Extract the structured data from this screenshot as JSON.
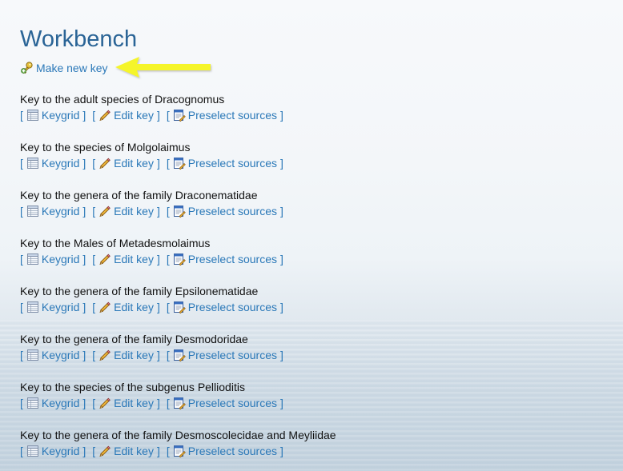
{
  "page": {
    "title": "Workbench",
    "make_new_key": {
      "label": "Make new key",
      "icon": "key-add-icon"
    },
    "annotation_arrow": {
      "color": "#f5f52a",
      "direction": "left"
    }
  },
  "link_labels": {
    "keygrid": "Keygrid",
    "edit_key": "Edit key",
    "preselect_sources": "Preselect sources",
    "open_bracket": "[",
    "close_bracket": "]"
  },
  "icons": {
    "keygrid": "grid-table-icon",
    "edit_key": "pencil-icon",
    "preselect_sources": "document-edit-icon"
  },
  "keys": [
    {
      "title": "Key to the adult species of Dracognomus"
    },
    {
      "title": "Key to the species of Molgolaimus"
    },
    {
      "title": "Key to the genera of the family Draconematidae"
    },
    {
      "title": "Key to the Males of Metadesmolaimus"
    },
    {
      "title": "Key to the genera of the family Epsilonematidae"
    },
    {
      "title": "Key to the genera of the family Desmodoridae"
    },
    {
      "title": "Key to the species of the subgenus Pellioditis"
    },
    {
      "title": "Key to the genera of the family Desmoscolecidae and Meyliidae"
    }
  ],
  "colors": {
    "title": "#2a6496",
    "link": "#2a78b8",
    "text": "#111111"
  }
}
